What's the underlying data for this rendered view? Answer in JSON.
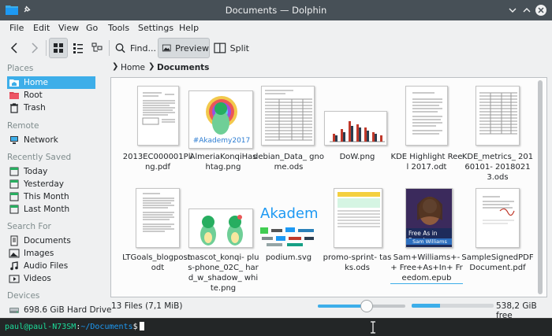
{
  "window": {
    "title": "Documents — Dolphin"
  },
  "menu": [
    "File",
    "Edit",
    "View",
    "Go",
    "Tools",
    "Settings",
    "Help"
  ],
  "toolbar": {
    "find_label": "Find...",
    "preview_label": "Preview",
    "split_label": "Split"
  },
  "places": {
    "sections": {
      "places": "Places",
      "remote": "Remote",
      "recent": "Recently Saved",
      "search": "Search For",
      "devices": "Devices"
    },
    "items": [
      "Home",
      "Root",
      "Trash"
    ],
    "remote": [
      "Network"
    ],
    "recent": [
      "Today",
      "Yesterday",
      "This Month",
      "Last Month"
    ],
    "search": [
      "Documents",
      "Images",
      "Audio Files",
      "Videos"
    ],
    "devices": [
      "698.6 GiB Hard Drive"
    ]
  },
  "breadcrumb": {
    "home": "Home",
    "current": "Documents"
  },
  "files": [
    "2013EC000001Pli ng.pdf",
    "AlmeriaKonqiHas htag.png",
    "debian_Data_ gnome.ods",
    "DoW.png",
    "KDE Highlight Reel 2017.odt",
    "KDE_metrics_ 20160101- 20180213.ods",
    "LTGoals_blogpost. odt",
    "mascot_konqi- plus-phone_02C_ hard_w_shadow_ white.png",
    "podium.svg",
    "promo-sprint- tasks.ods",
    "Sam+Williams+-+ Free+As+In+ Freedom.epub",
    "SampleSignedPDF Document.pdf"
  ],
  "thumb_text": {
    "akademy_hashtag": "#Akademy2017",
    "akademy_logo": "Akademy",
    "book_title": "Free As in Freedom",
    "book_author": "Sam Williams"
  },
  "status": {
    "files": "13 Files (7,1 MiB)",
    "free": "538,2 GiB free",
    "zoom_fraction": 0.56,
    "disk_used_fraction": 0.35
  },
  "terminal": {
    "user": "paul@paul-N73SM",
    "sep": ":",
    "dir": "~/Documents",
    "suffix": "$"
  },
  "colors": {
    "accent": "#3daee9",
    "titlebar": "#475057",
    "terminal_bg": "#232627"
  }
}
